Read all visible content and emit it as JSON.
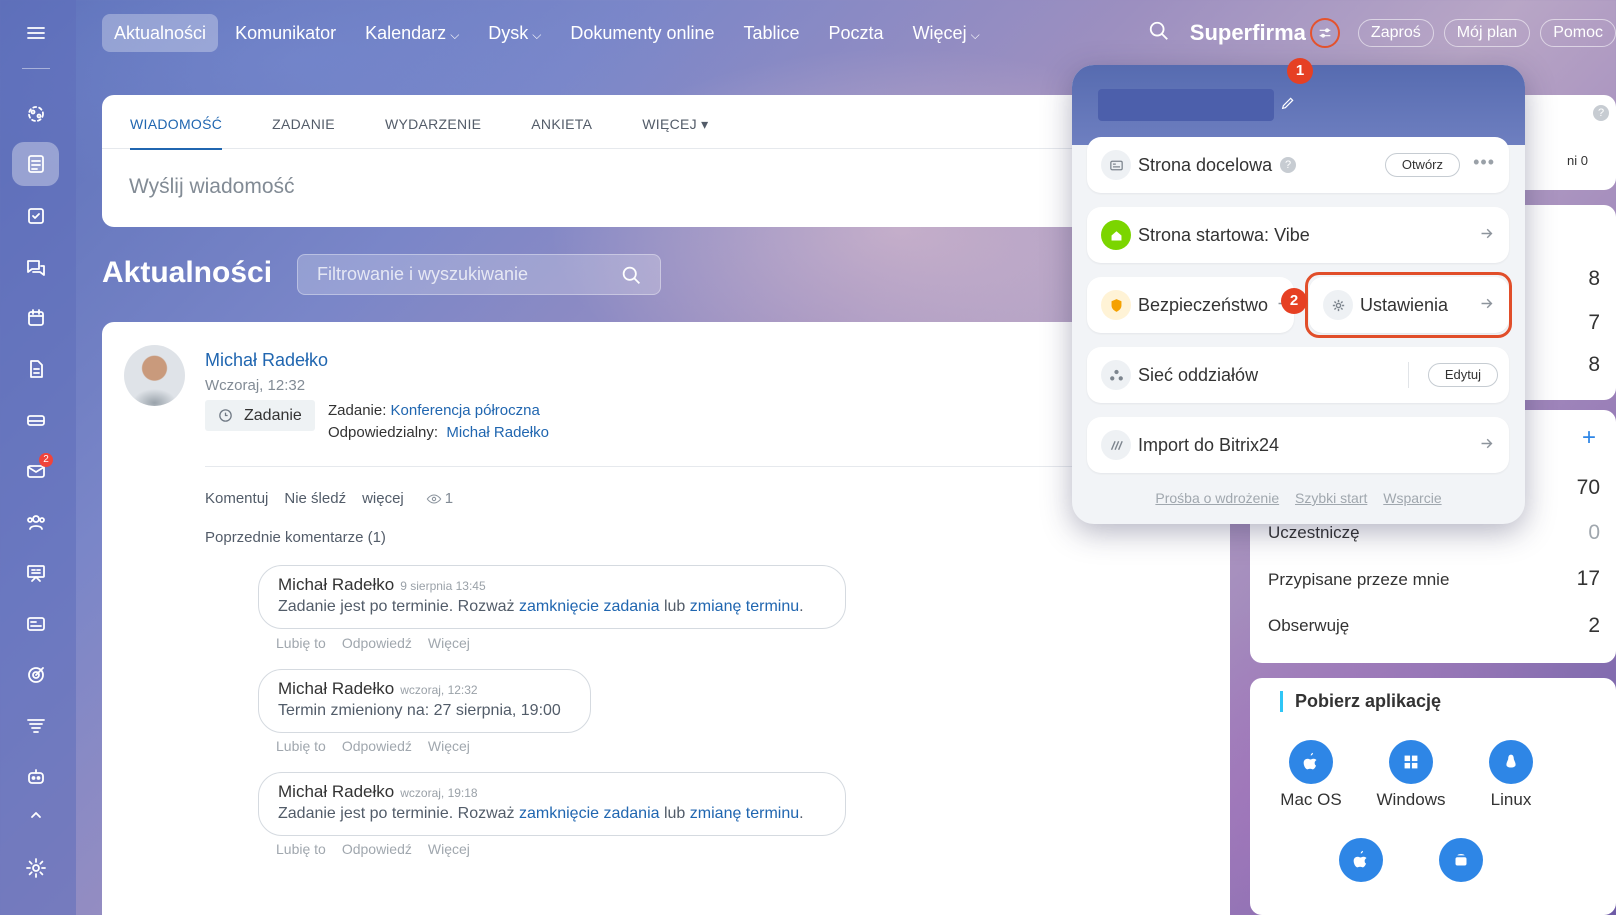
{
  "nav": {
    "items": [
      {
        "label": "Aktualności",
        "chev": ""
      },
      {
        "label": "Komunikator",
        "chev": ""
      },
      {
        "label": "Kalendarz",
        "chev": "⌵"
      },
      {
        "label": "Dysk",
        "chev": "⌵"
      },
      {
        "label": "Dokumenty online",
        "chev": ""
      },
      {
        "label": "Tablice",
        "chev": ""
      },
      {
        "label": "Poczta",
        "chev": ""
      },
      {
        "label": "Więcej",
        "chev": "⌵"
      }
    ],
    "brand": "Superfirma",
    "invite": "Zaproś",
    "plan": "Mój plan",
    "help": "Pomoc"
  },
  "markers": {
    "one": "1",
    "two": "2"
  },
  "sidebar": {
    "mail_badge": "2"
  },
  "composer": {
    "tabs": [
      "WIADOMOŚĆ",
      "ZADANIE",
      "WYDARZENIE",
      "ANKIETA",
      "WIĘCEJ ▾"
    ],
    "placeholder": "Wyślij wiadomość"
  },
  "feed": {
    "title": "Aktualności",
    "search_placeholder": "Filtrowanie i wyszukiwanie"
  },
  "post": {
    "author": "Michał Radełko",
    "date": "Wczoraj, 12:32",
    "chip": "Zadanie",
    "task_label": "Zadanie:",
    "task_name": "Konferencja półroczna",
    "responsible_label": "Odpowiedzialny:",
    "responsible_name": "Michał Radełko",
    "actions": [
      "Komentuj",
      "Nie śledź",
      "więcej"
    ],
    "views": "1",
    "prev_comments": "Poprzednie komentarze (1)"
  },
  "comments": [
    {
      "author": "Michał Radełko",
      "time": "9 sierpnia 13:45",
      "pre": "Zadanie jest po terminie. Rozważ ",
      "link1": "zamknięcie zadania",
      "mid": " lub ",
      "link2": "zmianę terminu",
      "post": "."
    },
    {
      "author": "Michał Radełko",
      "time": "wczoraj, 12:32",
      "pre": "Termin zmieniony na: 27 sierpnia, 19:00",
      "link1": "",
      "mid": "",
      "link2": "",
      "post": ""
    },
    {
      "author": "Michał Radełko",
      "time": "wczoraj, 19:18",
      "pre": "Zadanie jest po terminie. Rozważ ",
      "link1": "zamknięcie zadania",
      "mid": " lub ",
      "link2": "zmianę terminu",
      "post": "."
    }
  ],
  "comment_actions": [
    "Lubię to",
    "Odpowiedź",
    "Więcej"
  ],
  "right": {
    "top_partial": "ni 0",
    "nums": [
      "8",
      "7",
      "8"
    ],
    "plus": "+",
    "n70": "70",
    "rows": [
      {
        "label": "Uczestniczę",
        "value": "0"
      },
      {
        "label": "Przypisane przeze mnie",
        "value": "17"
      },
      {
        "label": "Obserwuję",
        "value": "2"
      }
    ],
    "apps_title": "Pobierz aplikację",
    "apps": [
      "Mac OS",
      "Windows",
      "Linux"
    ]
  },
  "popup": {
    "landing": "Strona docelowa",
    "help_q": "?",
    "open_btn": "Otwórz",
    "dots": "•••",
    "start": "Strona startowa: Vibe",
    "security": "Bezpieczeństwo",
    "settings": "Ustawienia",
    "branches": "Sieć oddziałów",
    "edit_btn": "Edytuj",
    "import": "Import do Bitrix24",
    "footer": [
      "Prośba o wdrożenie",
      "Szybki start",
      "Wsparcie"
    ]
  },
  "colors": {
    "accent": "#2066b0",
    "marker": "#e64023",
    "badge": "#f0443b"
  }
}
